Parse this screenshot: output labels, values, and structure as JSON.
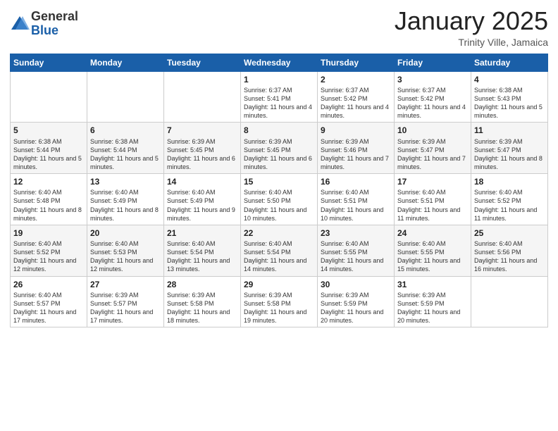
{
  "header": {
    "logo_general": "General",
    "logo_blue": "Blue",
    "month_title": "January 2025",
    "location": "Trinity Ville, Jamaica"
  },
  "days_of_week": [
    "Sunday",
    "Monday",
    "Tuesday",
    "Wednesday",
    "Thursday",
    "Friday",
    "Saturday"
  ],
  "weeks": [
    [
      {
        "day": "",
        "info": ""
      },
      {
        "day": "",
        "info": ""
      },
      {
        "day": "",
        "info": ""
      },
      {
        "day": "1",
        "info": "Sunrise: 6:37 AM\nSunset: 5:41 PM\nDaylight: 11 hours and 4 minutes."
      },
      {
        "day": "2",
        "info": "Sunrise: 6:37 AM\nSunset: 5:42 PM\nDaylight: 11 hours and 4 minutes."
      },
      {
        "day": "3",
        "info": "Sunrise: 6:37 AM\nSunset: 5:42 PM\nDaylight: 11 hours and 4 minutes."
      },
      {
        "day": "4",
        "info": "Sunrise: 6:38 AM\nSunset: 5:43 PM\nDaylight: 11 hours and 5 minutes."
      }
    ],
    [
      {
        "day": "5",
        "info": "Sunrise: 6:38 AM\nSunset: 5:44 PM\nDaylight: 11 hours and 5 minutes."
      },
      {
        "day": "6",
        "info": "Sunrise: 6:38 AM\nSunset: 5:44 PM\nDaylight: 11 hours and 5 minutes."
      },
      {
        "day": "7",
        "info": "Sunrise: 6:39 AM\nSunset: 5:45 PM\nDaylight: 11 hours and 6 minutes."
      },
      {
        "day": "8",
        "info": "Sunrise: 6:39 AM\nSunset: 5:45 PM\nDaylight: 11 hours and 6 minutes."
      },
      {
        "day": "9",
        "info": "Sunrise: 6:39 AM\nSunset: 5:46 PM\nDaylight: 11 hours and 7 minutes."
      },
      {
        "day": "10",
        "info": "Sunrise: 6:39 AM\nSunset: 5:47 PM\nDaylight: 11 hours and 7 minutes."
      },
      {
        "day": "11",
        "info": "Sunrise: 6:39 AM\nSunset: 5:47 PM\nDaylight: 11 hours and 8 minutes."
      }
    ],
    [
      {
        "day": "12",
        "info": "Sunrise: 6:40 AM\nSunset: 5:48 PM\nDaylight: 11 hours and 8 minutes."
      },
      {
        "day": "13",
        "info": "Sunrise: 6:40 AM\nSunset: 5:49 PM\nDaylight: 11 hours and 8 minutes."
      },
      {
        "day": "14",
        "info": "Sunrise: 6:40 AM\nSunset: 5:49 PM\nDaylight: 11 hours and 9 minutes."
      },
      {
        "day": "15",
        "info": "Sunrise: 6:40 AM\nSunset: 5:50 PM\nDaylight: 11 hours and 10 minutes."
      },
      {
        "day": "16",
        "info": "Sunrise: 6:40 AM\nSunset: 5:51 PM\nDaylight: 11 hours and 10 minutes."
      },
      {
        "day": "17",
        "info": "Sunrise: 6:40 AM\nSunset: 5:51 PM\nDaylight: 11 hours and 11 minutes."
      },
      {
        "day": "18",
        "info": "Sunrise: 6:40 AM\nSunset: 5:52 PM\nDaylight: 11 hours and 11 minutes."
      }
    ],
    [
      {
        "day": "19",
        "info": "Sunrise: 6:40 AM\nSunset: 5:52 PM\nDaylight: 11 hours and 12 minutes."
      },
      {
        "day": "20",
        "info": "Sunrise: 6:40 AM\nSunset: 5:53 PM\nDaylight: 11 hours and 12 minutes."
      },
      {
        "day": "21",
        "info": "Sunrise: 6:40 AM\nSunset: 5:54 PM\nDaylight: 11 hours and 13 minutes."
      },
      {
        "day": "22",
        "info": "Sunrise: 6:40 AM\nSunset: 5:54 PM\nDaylight: 11 hours and 14 minutes."
      },
      {
        "day": "23",
        "info": "Sunrise: 6:40 AM\nSunset: 5:55 PM\nDaylight: 11 hours and 14 minutes."
      },
      {
        "day": "24",
        "info": "Sunrise: 6:40 AM\nSunset: 5:55 PM\nDaylight: 11 hours and 15 minutes."
      },
      {
        "day": "25",
        "info": "Sunrise: 6:40 AM\nSunset: 5:56 PM\nDaylight: 11 hours and 16 minutes."
      }
    ],
    [
      {
        "day": "26",
        "info": "Sunrise: 6:40 AM\nSunset: 5:57 PM\nDaylight: 11 hours and 17 minutes."
      },
      {
        "day": "27",
        "info": "Sunrise: 6:39 AM\nSunset: 5:57 PM\nDaylight: 11 hours and 17 minutes."
      },
      {
        "day": "28",
        "info": "Sunrise: 6:39 AM\nSunset: 5:58 PM\nDaylight: 11 hours and 18 minutes."
      },
      {
        "day": "29",
        "info": "Sunrise: 6:39 AM\nSunset: 5:58 PM\nDaylight: 11 hours and 19 minutes."
      },
      {
        "day": "30",
        "info": "Sunrise: 6:39 AM\nSunset: 5:59 PM\nDaylight: 11 hours and 20 minutes."
      },
      {
        "day": "31",
        "info": "Sunrise: 6:39 AM\nSunset: 5:59 PM\nDaylight: 11 hours and 20 minutes."
      },
      {
        "day": "",
        "info": ""
      }
    ]
  ]
}
